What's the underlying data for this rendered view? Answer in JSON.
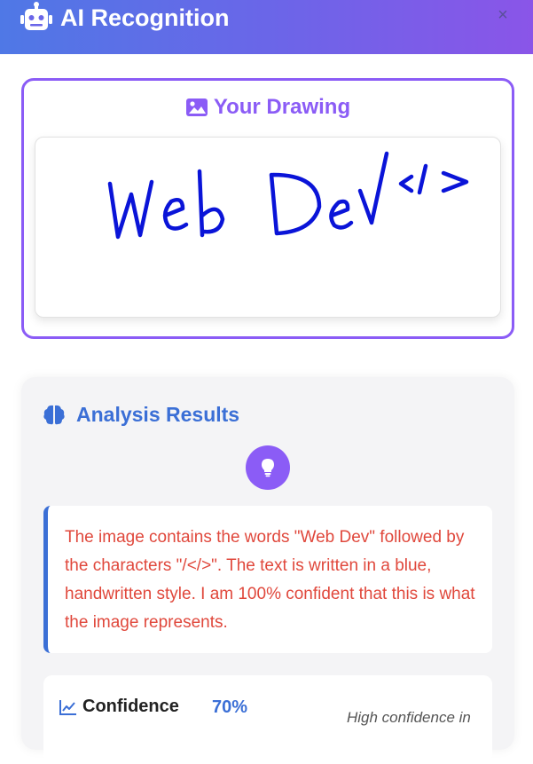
{
  "header": {
    "title": "AI Recognition",
    "icon": "robot-icon",
    "close_icon": "close-icon",
    "close_label": "×"
  },
  "drawing": {
    "title": "Your Drawing",
    "icon": "image-icon",
    "drawn_text": "Web Dev</>",
    "ink_color": "#0a14d8"
  },
  "results": {
    "title": "Analysis Results",
    "icon": "brain-icon",
    "bulb_icon": "lightbulb-icon",
    "analysis_text": "The image contains the words \"Web Dev\" followed by the characters \"/</>\". The text is written in a blue, handwritten style. I am 100% confident that this is what the image represents.",
    "confidence": {
      "icon": "chart-line-icon",
      "label": "Confidence",
      "value": "70%",
      "note": "High confidence in"
    }
  },
  "colors": {
    "header_start": "#4f78e6",
    "header_end": "#8a55e8",
    "accent_purple": "#8b5cf6",
    "accent_blue": "#3b6fd6",
    "analysis_text": "#e0483c"
  }
}
